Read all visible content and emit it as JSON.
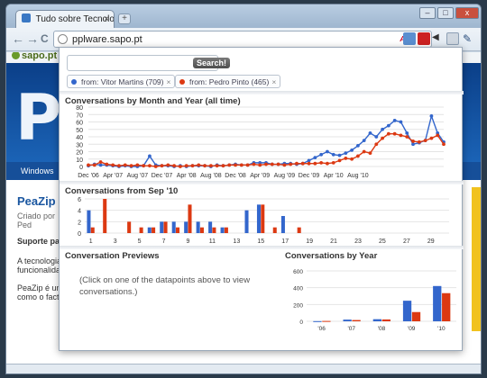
{
  "browser": {
    "tab_title": "Tudo sobre Tecnologia, S...",
    "tab_close": "×",
    "new_tab": "+",
    "url": "pplware.sapo.pt",
    "abp_label": "ABP",
    "nav_back": "←",
    "nav_forward": "→",
    "nav_reload": "C",
    "window_buttons": {
      "minimize": "–",
      "maximize": "□",
      "close": "x"
    }
  },
  "site": {
    "sapo_label": "sapo.pt",
    "logo_letter": "P",
    "nav_item": "Windows",
    "article_title": "PeaZip",
    "article_meta": "Criado por Ped",
    "article_lead": "Suporte para",
    "article_body_1": "A tecnologia",
    "article_body_2": "funcionalida",
    "article_body_3": "PeaZip é um",
    "article_body_4": "como o facto"
  },
  "popup": {
    "search_button": "Search!",
    "search_value": "",
    "chips": [
      {
        "label": "from: Vitor Martins (709)",
        "color": "#3366cc",
        "remove": "×"
      },
      {
        "label": "from: Pedro Pinto (465)",
        "color": "#dc3912",
        "remove": "×"
      }
    ],
    "month_heading": "Conversations by Month and Year (all time)",
    "day_heading": "Conversations from Sep '10",
    "preview_heading": "Conversation Previews",
    "preview_text": "(Click on one of the datapoints above to view conversations.)",
    "year_heading": "Conversations by Year"
  },
  "colors": {
    "series_a": "#3366cc",
    "series_b": "#dc3912"
  },
  "chart_data": [
    {
      "type": "line",
      "title": "Conversations by Month and Year (all time)",
      "ylim": [
        0,
        80
      ],
      "yticks": [
        0,
        10,
        20,
        30,
        40,
        50,
        60,
        70,
        80
      ],
      "xticklabels": [
        "Dec '06",
        "Apr '07",
        "Aug '07",
        "Dec '07",
        "Apr '08",
        "Aug '08",
        "Dec '08",
        "Apr '09",
        "Aug '09",
        "Dec '09",
        "Apr '10",
        "Aug '10"
      ],
      "grid": true,
      "series": [
        {
          "name": "from: Vitor Martins (709)",
          "values": [
            1,
            3,
            2,
            2,
            1,
            0,
            1,
            0,
            0,
            1,
            14,
            2,
            1,
            1,
            0,
            1,
            0,
            1,
            1,
            1,
            0,
            2,
            1,
            2,
            3,
            2,
            2,
            5,
            5,
            5,
            3,
            3,
            4,
            4,
            3,
            4,
            8,
            12,
            16,
            20,
            16,
            15,
            18,
            22,
            28,
            35,
            45,
            40,
            50,
            55,
            62,
            60,
            45,
            30,
            32,
            35,
            68,
            45,
            33
          ]
        },
        {
          "name": "from: Pedro Pinto (465)",
          "values": [
            2,
            2,
            6,
            3,
            2,
            1,
            2,
            1,
            2,
            1,
            1,
            0,
            1,
            2,
            1,
            0,
            1,
            1,
            2,
            1,
            1,
            1,
            1,
            2,
            2,
            2,
            2,
            3,
            2,
            3,
            3,
            3,
            2,
            3,
            4,
            4,
            4,
            4,
            5,
            4,
            5,
            8,
            11,
            10,
            14,
            20,
            18,
            30,
            38,
            44,
            44,
            42,
            40,
            34,
            33,
            35,
            38,
            42,
            30
          ]
        }
      ]
    },
    {
      "type": "bar",
      "title": "Conversations from Sep '10",
      "ylim": [
        0,
        6
      ],
      "yticks": [
        0,
        2,
        4,
        6
      ],
      "categories": [
        1,
        2,
        3,
        4,
        5,
        6,
        7,
        8,
        9,
        10,
        11,
        12,
        13,
        14,
        15,
        16,
        17,
        18,
        19,
        20,
        21,
        22,
        23,
        24,
        25,
        26,
        27,
        28,
        29,
        30
      ],
      "xticklabels": [
        "1",
        "3",
        "5",
        "7",
        "9",
        "11",
        "13",
        "15",
        "17",
        "19",
        "21",
        "23",
        "25",
        "27",
        "29"
      ],
      "series": [
        {
          "name": "from: Vitor Martins (709)",
          "values": [
            4,
            0,
            0,
            0,
            0,
            1,
            2,
            2,
            2,
            2,
            2,
            1,
            0,
            4,
            5,
            0,
            3,
            0,
            0,
            0,
            0,
            0,
            0,
            0,
            0,
            0,
            0,
            0,
            0,
            0
          ]
        },
        {
          "name": "from: Pedro Pinto (465)",
          "values": [
            1,
            6,
            0,
            2,
            1,
            1,
            2,
            1,
            5,
            1,
            1,
            1,
            0,
            0,
            5,
            1,
            0,
            1,
            0,
            0,
            0,
            0,
            0,
            0,
            0,
            0,
            0,
            0,
            0,
            0
          ]
        }
      ]
    },
    {
      "type": "bar",
      "title": "Conversations by Year",
      "ylim": [
        0,
        600
      ],
      "yticks": [
        0,
        200,
        400,
        600
      ],
      "categories": [
        "'06",
        "'07",
        "'08",
        "'09",
        "'10"
      ],
      "series": [
        {
          "name": "from: Vitor Martins (709)",
          "values": [
            2,
            20,
            25,
            245,
            420
          ]
        },
        {
          "name": "from: Pedro Pinto (465)",
          "values": [
            4,
            15,
            22,
            110,
            335
          ]
        }
      ]
    }
  ]
}
